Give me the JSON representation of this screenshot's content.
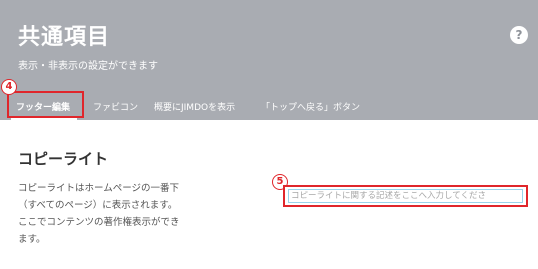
{
  "header": {
    "title": "共通項目",
    "subtitle": "表示・非表示の設定ができます",
    "help_glyph": "?"
  },
  "tabs": [
    {
      "label": "フッター編集",
      "active": true
    },
    {
      "label": "ファビコン",
      "active": false
    },
    {
      "label": "概要にJIMDOを表示",
      "active": false
    },
    {
      "label": "「トップへ戻る」ボタン",
      "active": false
    }
  ],
  "annotations": {
    "tab_marker": "4",
    "input_marker": "5",
    "color": "#e0262b"
  },
  "copyright": {
    "heading": "コピーライト",
    "description": "コピーライトはホームページの一番下（すべてのページ）に表示されます。ここでコンテンツの著作権表示ができます。",
    "input_placeholder": "コピーライトに関する記述をここへ入力してくださ",
    "input_value": ""
  }
}
